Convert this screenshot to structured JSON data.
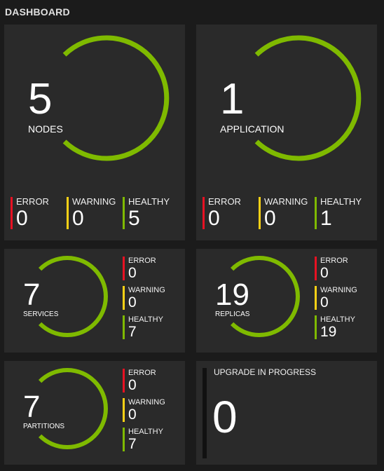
{
  "header": {
    "title": "DASHBOARD"
  },
  "colors": {
    "ring": "#7fba00",
    "error": "#e81123",
    "warning": "#fcd116",
    "healthy": "#7fba00",
    "tile": "#2a2a2a",
    "background": "#1b1b1b"
  },
  "nodes": {
    "count": "5",
    "label": "NODES",
    "error_label": "ERROR",
    "error": "0",
    "warning_label": "WARNING",
    "warning": "0",
    "healthy_label": "HEALTHY",
    "healthy": "5"
  },
  "applications": {
    "count": "1",
    "label": "APPLICATION",
    "error_label": "ERROR",
    "error": "0",
    "warning_label": "WARNING",
    "warning": "0",
    "healthy_label": "HEALTHY",
    "healthy": "1"
  },
  "services": {
    "count": "7",
    "label": "SERVICES",
    "error_label": "ERROR",
    "error": "0",
    "warning_label": "WARNING",
    "warning": "0",
    "healthy_label": "HEALTHY",
    "healthy": "7"
  },
  "replicas": {
    "count": "19",
    "label": "REPLICAS",
    "error_label": "ERROR",
    "error": "0",
    "warning_label": "WARNING",
    "warning": "0",
    "healthy_label": "HEALTHY",
    "healthy": "19"
  },
  "partitions": {
    "count": "7",
    "label": "PARTITIONS",
    "error_label": "ERROR",
    "error": "0",
    "warning_label": "WARNING",
    "warning": "0",
    "healthy_label": "HEALTHY",
    "healthy": "7"
  },
  "upgrade": {
    "title": "UPGRADE IN PROGRESS",
    "count": "0"
  }
}
